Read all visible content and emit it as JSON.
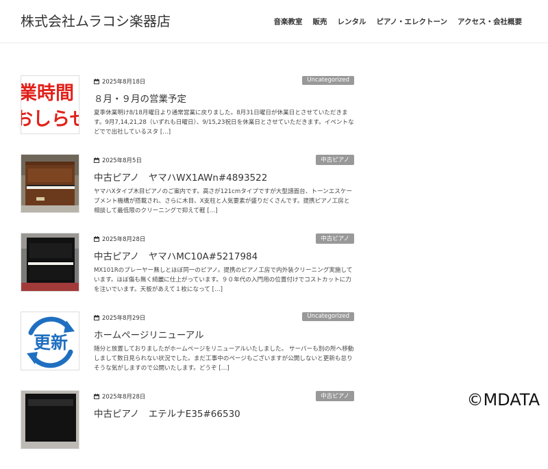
{
  "site": {
    "title": "株式会社ムラコシ楽器店"
  },
  "nav": [
    {
      "label": "音楽教室"
    },
    {
      "label": "販売"
    },
    {
      "label": "レンタル"
    },
    {
      "label": "ピアノ・エレクトーン"
    },
    {
      "label": "アクセス・会社概要"
    }
  ],
  "posts": [
    {
      "date": "2025年8月18日",
      "category": "Uncategorized",
      "title": "８月・９月の営業予定",
      "excerpt": "夏季休業明け8/18月曜日より通常営業に戻りました。8月31日曜日が休業日とさせていただきます。9月7,14,21,28（いずれも日曜日）、9/15,23祝日を休業日とさせていただきます。イベントなどでで出社しているスタ […]",
      "thumb_icon": "business-hours-notice-icon"
    },
    {
      "date": "2025年8月5日",
      "category": "中古ピアノ",
      "title": "中古ピアノ　ヤマハWX1AWn#4893522",
      "excerpt": "ヤマハXタイプ木目ピアノのご案内です。高さが121cmタイプですが大型譜面台、トーンエスケープメント機構が搭載され、さらに木目、X支柱と人気要素が盛りだくさんです。提携ピアノ工房と相談して最低限のクリーニングで抑えて軽 […]",
      "thumb_icon": "wood-upright-piano-photo"
    },
    {
      "date": "2025年8月28日",
      "category": "中古ピアノ",
      "title": "中古ピアノ　ヤマハMC10A#5217984",
      "excerpt": "MX101Rのプレーヤー無しとほぼ同一のピアノ。提携のピアノ工房で内外装クリーニング実施しています。ほぼ傷も無く綺麗に仕上がっています。９０年代の入門用の位置付けでコストカットに力を注いでいます。天板があえて１枚になって […]",
      "thumb_icon": "black-upright-piano-photo"
    },
    {
      "date": "2025年8月29日",
      "category": "Uncategorized",
      "title": "ホームページリニューアル",
      "excerpt": "随分と放置しておりましたがホームページをリニューアルいたしました。 サーバーも別の所へ移動しまして数日見られない状況でした。まだ工事中のページもございますが公開しないと更新も怠りそうな気がしますので公開いたします。どうぞ […]",
      "thumb_icon": "renewal-icon"
    },
    {
      "date": "2025年8月28日",
      "category": "中古ピアノ",
      "title": "中古ピアノ　エテルナE35#66530",
      "excerpt": "",
      "thumb_icon": "black-piano-photo"
    }
  ],
  "thumb_text": {
    "notice_line1": "業時間",
    "notice_line2": "おしらせ",
    "renewal_text": "更新"
  },
  "watermark": "©MDATA",
  "colors": {
    "badge": "#999999",
    "text": "#333333",
    "notice_red": "#e1211b",
    "renewal_blue": "#1f6fc1"
  }
}
